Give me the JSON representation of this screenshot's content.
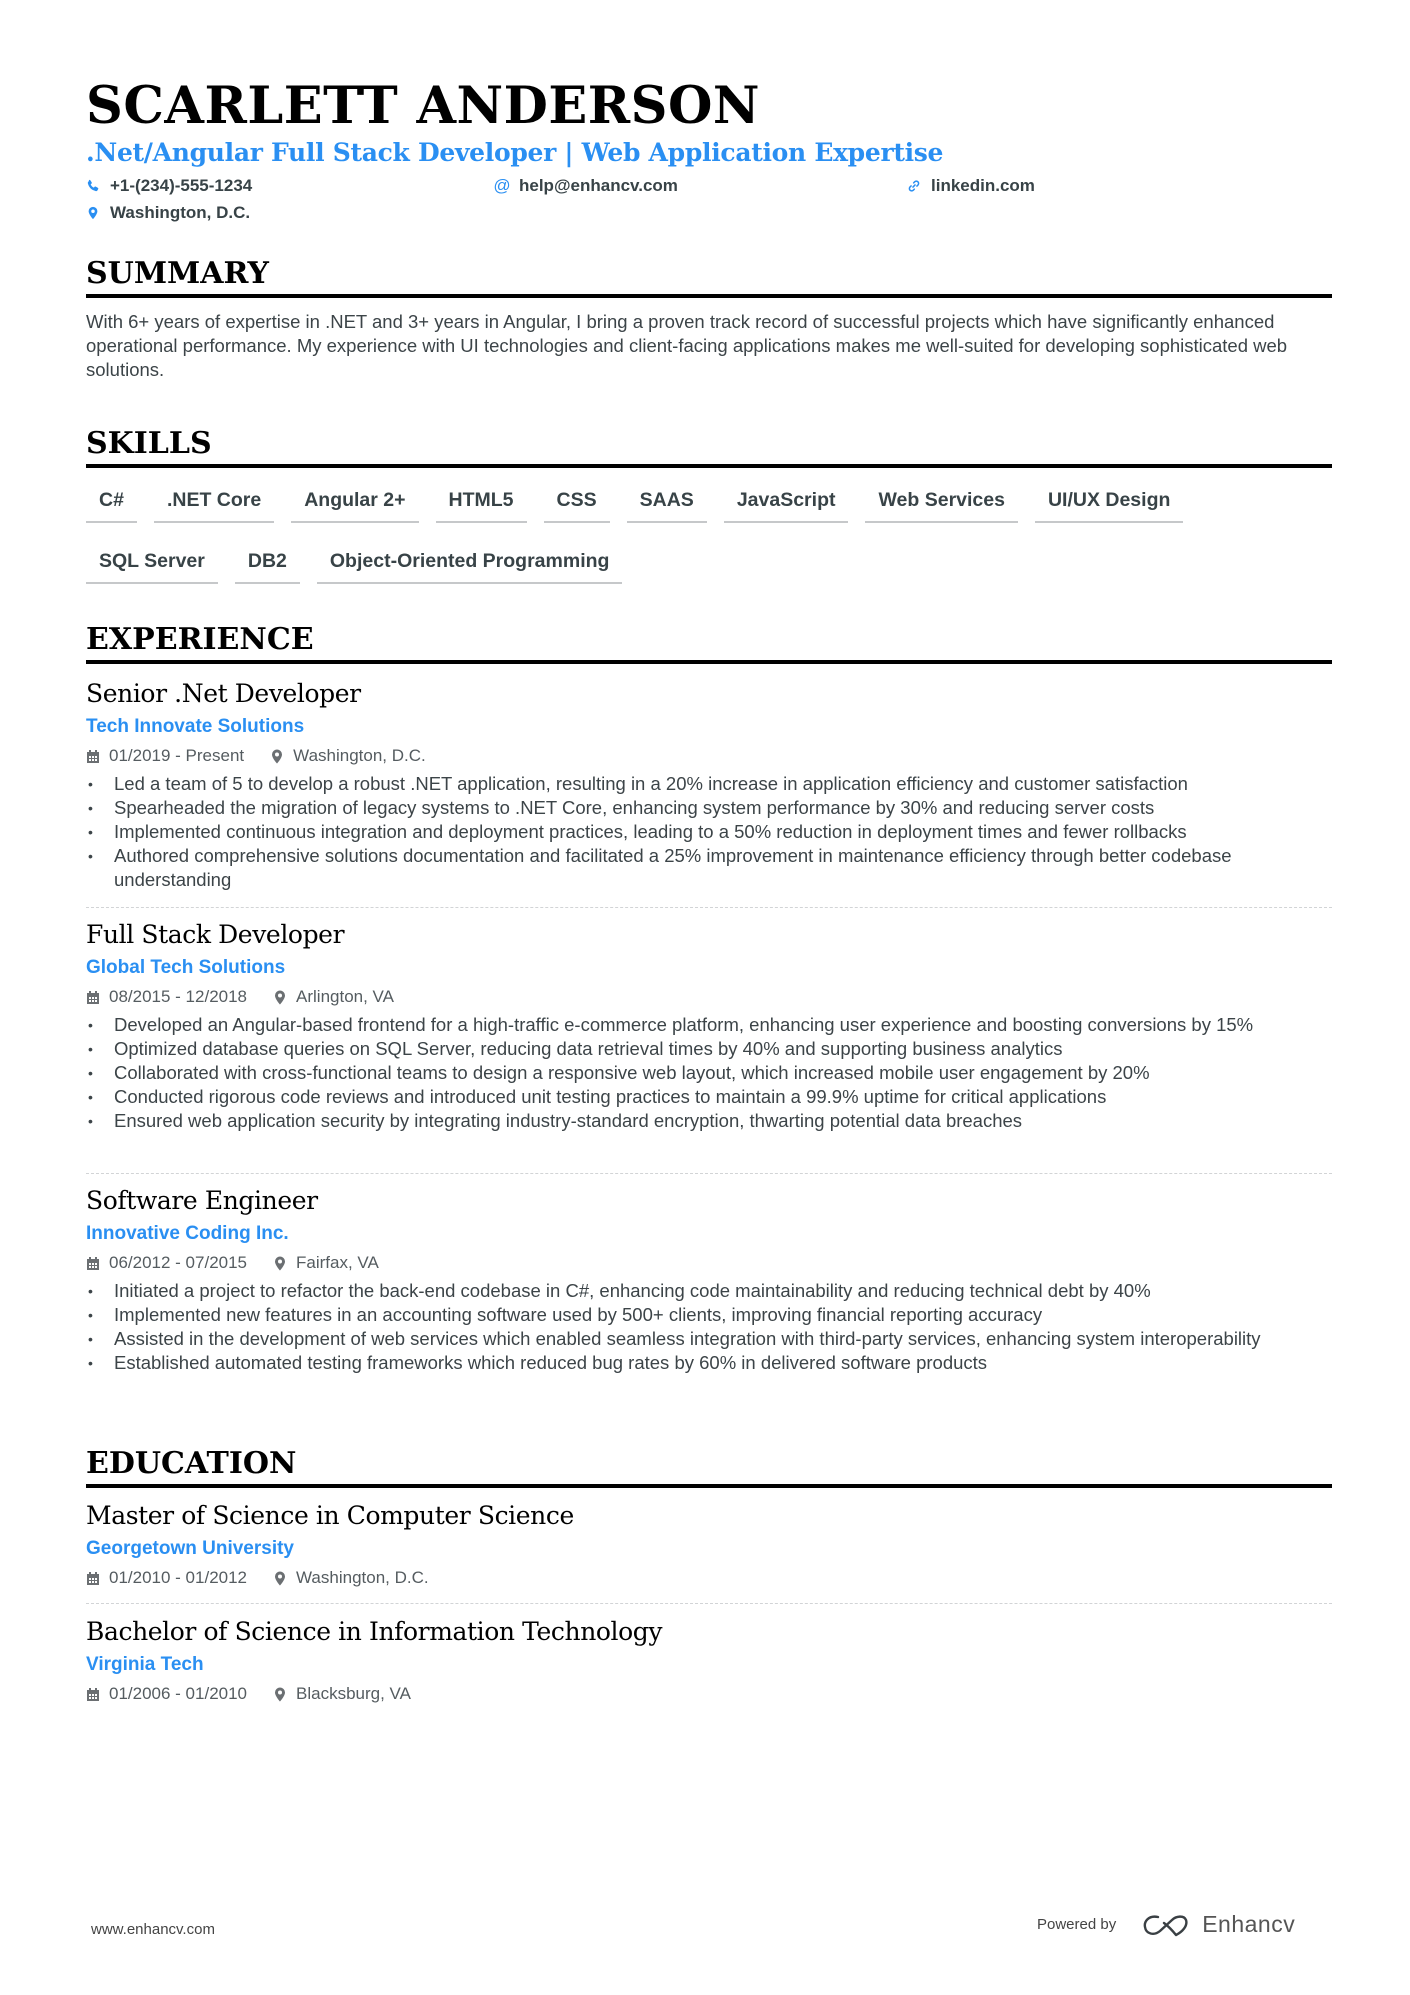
{
  "header": {
    "name": "SCARLETT ANDERSON",
    "headline": ".Net/Angular Full Stack Developer | Web Application Expertise",
    "contacts": [
      {
        "icon": "phone-icon",
        "text": "+1-(234)-555-1234"
      },
      {
        "icon": "at-icon",
        "text": "help@enhancv.com"
      },
      {
        "icon": "link-icon",
        "text": "linkedin.com"
      },
      {
        "icon": "location-pin-icon",
        "text": "Washington, D.C."
      }
    ]
  },
  "colors": {
    "accent": "#2a8ff2",
    "heading": "#000000",
    "text": "#3c4448"
  },
  "summary": {
    "title": "SUMMARY",
    "text": "With 6+ years of expertise in .NET and 3+ years in Angular, I bring a proven track record of successful projects which have significantly enhanced operational performance. My experience with UI technologies and client-facing applications makes me well-suited for developing sophisticated web solutions."
  },
  "skills": {
    "title": "SKILLS",
    "items": [
      "C#",
      ".NET Core",
      "Angular 2+",
      "HTML5",
      "CSS",
      "SAAS",
      "JavaScript",
      "Web Services",
      "UI/UX Design",
      "SQL Server",
      "DB2",
      "Object-Oriented Programming"
    ]
  },
  "experience": {
    "title": "EXPERIENCE",
    "items": [
      {
        "role": "Senior .Net Developer",
        "company": "Tech Innovate Solutions",
        "dates": "01/2019 - Present",
        "location": "Washington, D.C.",
        "bullets": [
          "Led a team of 5 to develop a robust .NET application, resulting in a 20% increase in application efficiency and customer satisfaction",
          "Spearheaded the migration of legacy systems to .NET Core, enhancing system performance by 30% and reducing server costs",
          "Implemented continuous integration and deployment practices, leading to a 50% reduction in deployment times and fewer rollbacks",
          "Authored comprehensive solutions documentation and facilitated a 25% improvement in maintenance efficiency through better codebase understanding"
        ]
      },
      {
        "role": "Full Stack Developer",
        "company": "Global Tech Solutions",
        "dates": "08/2015 - 12/2018",
        "location": "Arlington, VA",
        "bullets": [
          "Developed an Angular-based frontend for a high-traffic e-commerce platform, enhancing user experience and boosting conversions by 15%",
          "Optimized database queries on SQL Server, reducing data retrieval times by 40% and supporting business analytics",
          "Collaborated with cross-functional teams to design a responsive web layout, which increased mobile user engagement by 20%",
          "Conducted rigorous code reviews and introduced unit testing practices to maintain a 99.9% uptime for critical applications",
          "Ensured web application security by integrating industry-standard encryption, thwarting potential data breaches"
        ]
      },
      {
        "role": "Software Engineer",
        "company": "Innovative Coding Inc.",
        "dates": "06/2012 - 07/2015",
        "location": "Fairfax, VA",
        "bullets": [
          "Initiated a project to refactor the back-end codebase in C#, enhancing code maintainability and reducing technical debt by 40%",
          "Implemented new features in an accounting software used by 500+ clients, improving financial reporting accuracy",
          "Assisted in the development of web services which enabled seamless integration with third-party services, enhancing system interoperability",
          "Established automated testing frameworks which reduced bug rates by 60% in delivered software products"
        ]
      }
    ]
  },
  "education": {
    "title": "EDUCATION",
    "items": [
      {
        "degree": "Master of Science in Computer Science",
        "school": "Georgetown University",
        "dates": "01/2010 - 01/2012",
        "location": "Washington, D.C."
      },
      {
        "degree": "Bachelor of Science in Information Technology",
        "school": "Virginia Tech",
        "dates": "01/2006 - 01/2010",
        "location": "Blacksburg, VA"
      }
    ]
  },
  "footer": {
    "website": "www.enhancv.com",
    "powered_by": "Powered by",
    "brand": "Enhancv"
  }
}
